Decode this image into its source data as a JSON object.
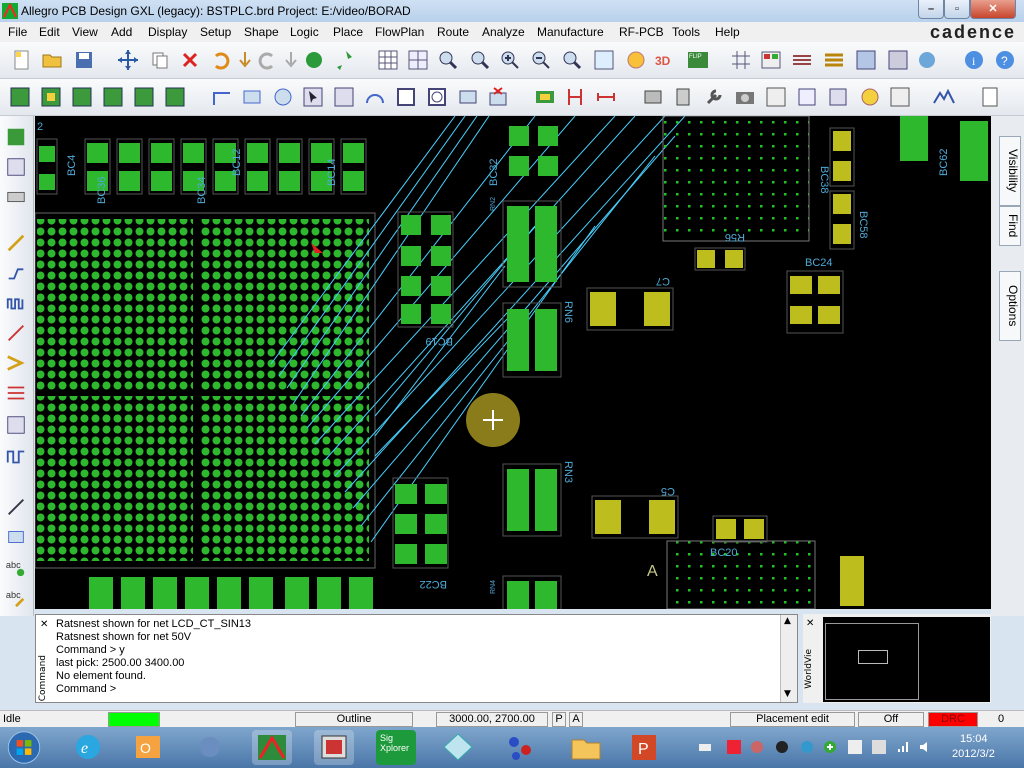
{
  "window": {
    "title": "Allegro PCB Design GXL (legacy): BSTPLC.brd  Project: E:/video/BORAD",
    "min": "–",
    "max": "▫",
    "close": "✕"
  },
  "menu": [
    "File",
    "Edit",
    "View",
    "Add",
    "Display",
    "Setup",
    "Shape",
    "Logic",
    "Place",
    "FlowPlan",
    "Route",
    "Analyze",
    "Manufacture",
    "RF-PCB",
    "Tools",
    "Help"
  ],
  "brand": "cadence",
  "right_tabs": [
    "Visibility",
    "Find",
    "Options"
  ],
  "canvas": {
    "refdes": [
      "BC4",
      "BC36",
      "BC34",
      "BC12",
      "BC14",
      "BC32",
      "BC38",
      "BC58",
      "BC62",
      "BC22",
      "BC19",
      "BC20",
      "BC24",
      "RN6",
      "RN3",
      "C5",
      "C7",
      "R56",
      "A",
      "RN2",
      "RN4"
    ],
    "cursor_icon": "crosshair-icon"
  },
  "console": {
    "label": "Command",
    "lines": [
      "Ratsnest shown for net LCD_CT_SIN13",
      "Ratsnest shown for net 50V",
      "Command > y",
      "last pick:  2500.00  3400.00",
      "No element found.",
      "Command >"
    ]
  },
  "worldview": {
    "label": "WorldVie"
  },
  "status": {
    "state": "Idle",
    "indicator_color": "#00ff00",
    "layer": "Outline",
    "coords": "3000.00, 2700.00",
    "p": "P",
    "a": "A",
    "mode": "Placement edit",
    "off": "Off",
    "drc": "DRC",
    "drc_color": "#ff0000",
    "count": "0"
  },
  "taskbar": {
    "apps": [
      "windows-start",
      "ie",
      "outlook",
      "remote",
      "allegro",
      "cap",
      "sigxplorer",
      "viewer",
      "netviz",
      "explorer",
      "powerpoint"
    ],
    "sig_label": "Sig\nXplorer",
    "time": "15:04",
    "date": "2012/3/2"
  }
}
